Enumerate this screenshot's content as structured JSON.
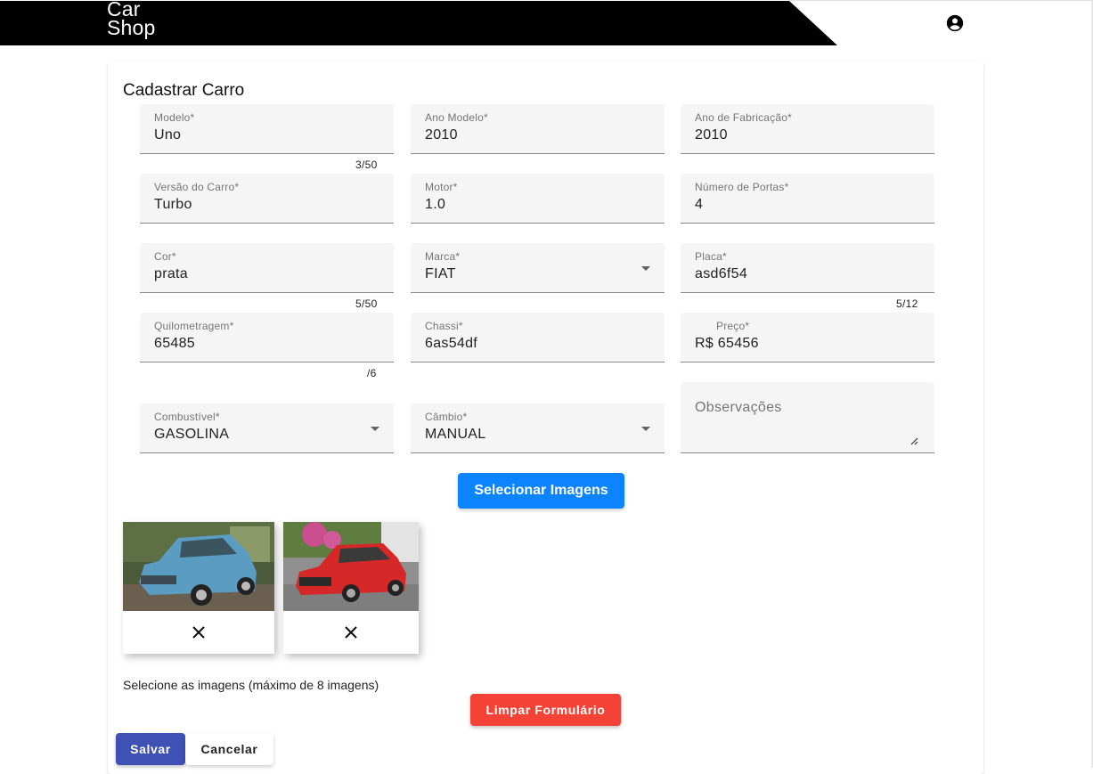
{
  "header": {
    "brand_line1": "Car",
    "brand_line2": "Shop",
    "account_icon": "account-circle-icon"
  },
  "form": {
    "title": "Cadastrar Carro",
    "fields": {
      "modelo": {
        "label": "Modelo*",
        "value": "Uno",
        "hint": "3/50"
      },
      "ano_modelo": {
        "label": "Ano Modelo*",
        "value": "2010"
      },
      "ano_fabricacao": {
        "label": "Ano de Fabricação*",
        "value": "2010"
      },
      "versao": {
        "label": "Versão do Carro*",
        "value": "Turbo"
      },
      "motor": {
        "label": "Motor*",
        "value": "1.0"
      },
      "portas": {
        "label": "Número de Portas*",
        "value": "4"
      },
      "cor": {
        "label": "Cor*",
        "value": "prata",
        "hint": "5/50"
      },
      "marca": {
        "label": "Marca*",
        "value": "FIAT"
      },
      "placa": {
        "label": "Placa*",
        "value": "asd6f54",
        "hint": "5/12"
      },
      "quilometragem": {
        "label": "Quilometragem*",
        "value": "65485",
        "hint": "/6"
      },
      "chassi": {
        "label": "Chassi*",
        "value": "6as54df"
      },
      "preco": {
        "label": "Preço*",
        "value": "R$ 65456"
      },
      "combustivel": {
        "label": "Combustível*",
        "value": "GASOLINA"
      },
      "cambio": {
        "label": "Câmbio*",
        "value": "MANUAL"
      },
      "observacoes": {
        "placeholder": "Observações",
        "value": ""
      }
    },
    "select_images_label": "Selecionar Imagens",
    "images": [
      {
        "alt": "blue car photo",
        "remove_icon": "close-icon"
      },
      {
        "alt": "red car photo",
        "remove_icon": "close-icon"
      }
    ],
    "images_help": "Selecione as imagens (máximo de 8 imagens)",
    "clear_label": "Limpar Formulário",
    "save_label": "Salvar",
    "cancel_label": "Cancelar"
  },
  "colors": {
    "primary": "#3f51b5",
    "select_button": "#0d84ff",
    "clear_button": "#f44336",
    "field_bg": "#f5f5f5"
  }
}
